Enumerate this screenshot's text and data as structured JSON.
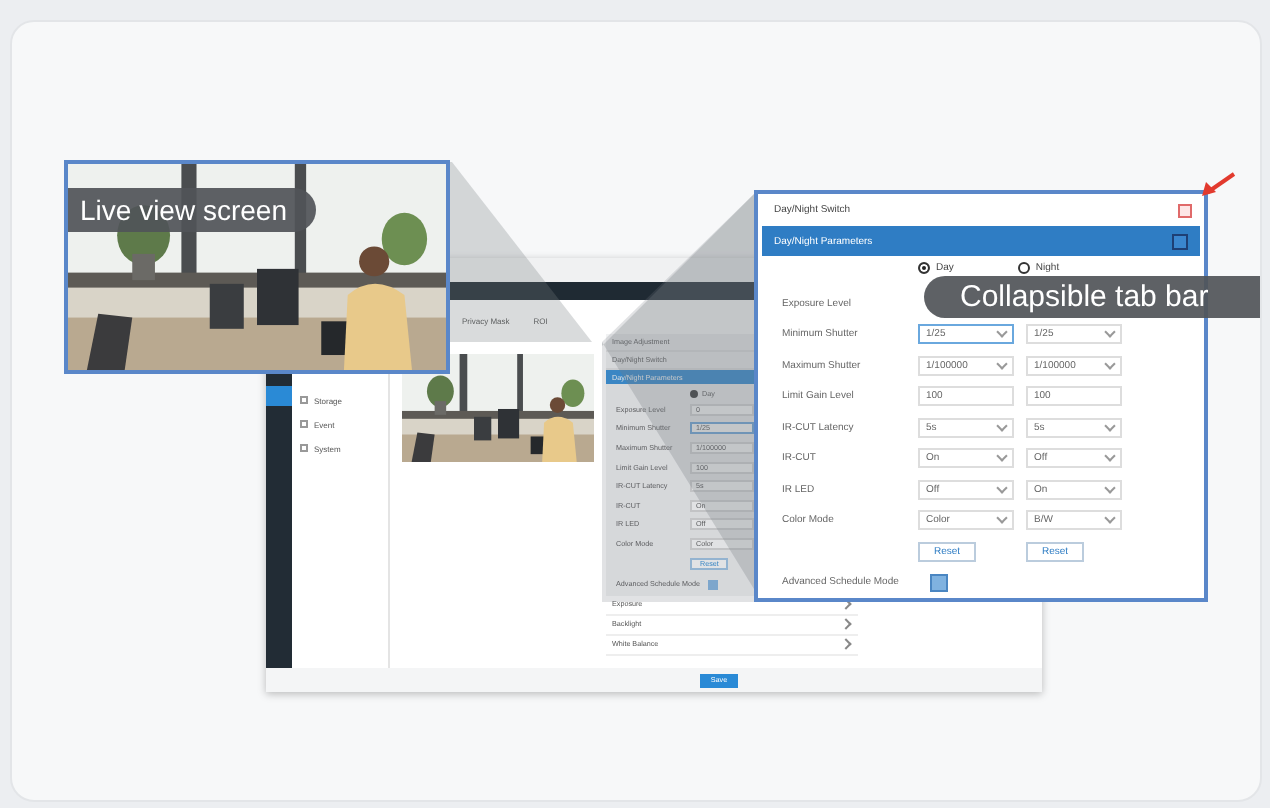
{
  "app": {
    "menu": [
      {
        "label": "Storage"
      },
      {
        "label": "Event"
      },
      {
        "label": "System"
      }
    ],
    "tabs": [
      {
        "label": "Privacy Mask",
        "selected": false
      },
      {
        "label": "ROI",
        "selected": false
      }
    ],
    "panel": {
      "sections": [
        {
          "label": "Image Adjustment"
        },
        {
          "label": "Day/Night Switch"
        }
      ],
      "bar": "Day/Night Parameters",
      "radio": {
        "label": "Day",
        "selected": true
      },
      "rows": [
        {
          "label": "Exposure Level",
          "value": "0"
        },
        {
          "label": "Minimum Shutter",
          "value": "1/25"
        },
        {
          "label": "Maximum Shutter",
          "value": "1/100000"
        },
        {
          "label": "Limit Gain Level",
          "value": "100"
        },
        {
          "label": "IR-CUT Latency",
          "value": "5s"
        },
        {
          "label": "IR-CUT",
          "value": "On"
        },
        {
          "label": "IR LED",
          "value": "Off"
        },
        {
          "label": "Color Mode",
          "value": "Color"
        }
      ],
      "reset": "Reset",
      "advanced": "Advanced Schedule Mode",
      "advanced_checked": true,
      "collapsed": [
        {
          "label": "Exposure"
        },
        {
          "label": "Backlight"
        },
        {
          "label": "White Balance"
        }
      ]
    },
    "save": "Save"
  },
  "live_callout": {
    "label": "Live view screen"
  },
  "dialog": {
    "title": "Day/Night Switch",
    "bar": "Day/Night Parameters",
    "expanded": true,
    "modes": [
      {
        "label": "Day",
        "selected": true
      },
      {
        "label": "Night",
        "selected": false
      }
    ],
    "rows": [
      {
        "label": "Exposure Level"
      },
      {
        "label": "Minimum Shutter",
        "kind": "select",
        "day": "1/25",
        "night": "1/25",
        "focused": true
      },
      {
        "label": "Maximum Shutter",
        "kind": "select",
        "day": "1/100000",
        "night": "1/100000",
        "focused": false
      },
      {
        "label": "Limit Gain Level",
        "kind": "input",
        "day": "100",
        "night": "100",
        "focused": false
      },
      {
        "label": "IR-CUT Latency",
        "kind": "select",
        "day": "5s",
        "night": "5s",
        "focused": false
      },
      {
        "label": "IR-CUT",
        "kind": "select",
        "day": "On",
        "night": "Off",
        "focused": false
      },
      {
        "label": "IR LED",
        "kind": "select",
        "day": "Off",
        "night": "On",
        "focused": false
      },
      {
        "label": "Color Mode",
        "kind": "select",
        "day": "Color",
        "night": "B/W",
        "focused": false
      }
    ],
    "reset": [
      "Reset",
      "Reset"
    ],
    "advanced": "Advanced Schedule Mode"
  },
  "tab_callout": {
    "label": "Collapsible tab bar"
  }
}
